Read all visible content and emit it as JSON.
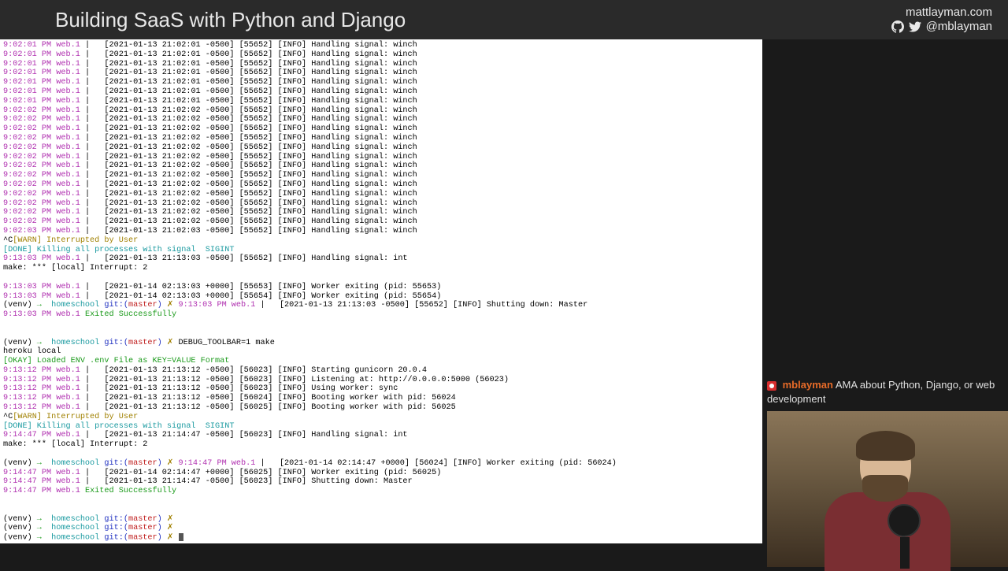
{
  "header": {
    "title": "Building SaaS with Python and Django",
    "site": "mattlayman.com",
    "handle": "@mblayman"
  },
  "chat": {
    "user": "mblayman",
    "msg": "AMA about Python, Django, or web development"
  },
  "term": {
    "winch01": [
      "9:02:01 PM web.1",
      "[2021-01-13 21:02:01 -0500] [55652] [INFO] Handling signal: winch"
    ],
    "winch02": [
      "9:02:02 PM web.1",
      "[2021-01-13 21:02:02 -0500] [55652] [INFO] Handling signal: winch"
    ],
    "winch03": [
      "9:02:03 PM web.1",
      "[2021-01-13 21:02:03 -0500] [55652] [INFO] Handling signal: winch"
    ],
    "ctrlc": "^C",
    "warn_int": "[WARN] Interrupted by User",
    "done_kill": "[DONE] Killing all processes with signal  SIGINT",
    "int_1303": [
      "9:13:03 PM web.1",
      "[2021-01-13 21:13:03 -0500] [55652] [INFO] Handling signal: int"
    ],
    "make_err": "make: *** [local] Interrupt: 2",
    "wexit53": [
      "9:13:03 PM web.1",
      "[2021-01-14 02:13:03 +0000] [55653] [INFO] Worker exiting (pid: 55653)"
    ],
    "wexit54": [
      "9:13:03 PM web.1",
      "[2021-01-14 02:13:03 +0000] [55654] [INFO] Worker exiting (pid: 55654)"
    ],
    "prompt_venv": "(venv) ",
    "prompt_arrow": "→  ",
    "prompt_dir": "homeschool ",
    "prompt_git": "git:(",
    "prompt_branch": "master",
    "prompt_close": ") ",
    "prompt_x": "✗ ",
    "shut_1303_ts": "9:13:03 PM web.1",
    "shut_1303_msg": "[2021-01-13 21:13:03 -0500] [55652] [INFO] Shutting down: Master",
    "exit_1303": [
      "9:13:03 PM web.1",
      "Exited Successfully"
    ],
    "cmd_debug": "DEBUG_TOOLBAR=1 make",
    "heroku": "heroku local",
    "okay_env": "[OKAY] Loaded ENV .env File as KEY=VALUE Format",
    "gstart": [
      "9:13:12 PM web.1",
      "[2021-01-13 21:13:12 -0500] [56023] [INFO] Starting gunicorn 20.0.4"
    ],
    "glisten": [
      "9:13:12 PM web.1",
      "[2021-01-13 21:13:12 -0500] [56023] [INFO] Listening at: http://0.0.0.0:5000 (56023)"
    ],
    "gworker": [
      "9:13:12 PM web.1",
      "[2021-01-13 21:13:12 -0500] [56023] [INFO] Using worker: sync"
    ],
    "gboot24": [
      "9:13:12 PM web.1",
      "[2021-01-13 21:13:12 -0500] [56024] [INFO] Booting worker with pid: 56024"
    ],
    "gboot25": [
      "9:13:12 PM web.1",
      "[2021-01-13 21:13:12 -0500] [56025] [INFO] Booting worker with pid: 56025"
    ],
    "int_1447": [
      "9:14:47 PM web.1",
      "[2021-01-13 21:14:47 -0500] [56023] [INFO] Handling signal: int"
    ],
    "shut_1447_ts": "9:14:47 PM web.1",
    "wexit24": "[2021-01-14 02:14:47 +0000] [56024] [INFO] Worker exiting (pid: 56024)",
    "wexit25": [
      "9:14:47 PM web.1",
      "[2021-01-14 02:14:47 +0000] [56025] [INFO] Worker exiting (pid: 56025)"
    ],
    "shut_1447_msg": [
      "9:14:47 PM web.1",
      "[2021-01-13 21:14:47 -0500] [56023] [INFO] Shutting down: Master"
    ],
    "exit_1447": [
      "9:14:47 PM web.1",
      "Exited Successfully"
    ]
  }
}
